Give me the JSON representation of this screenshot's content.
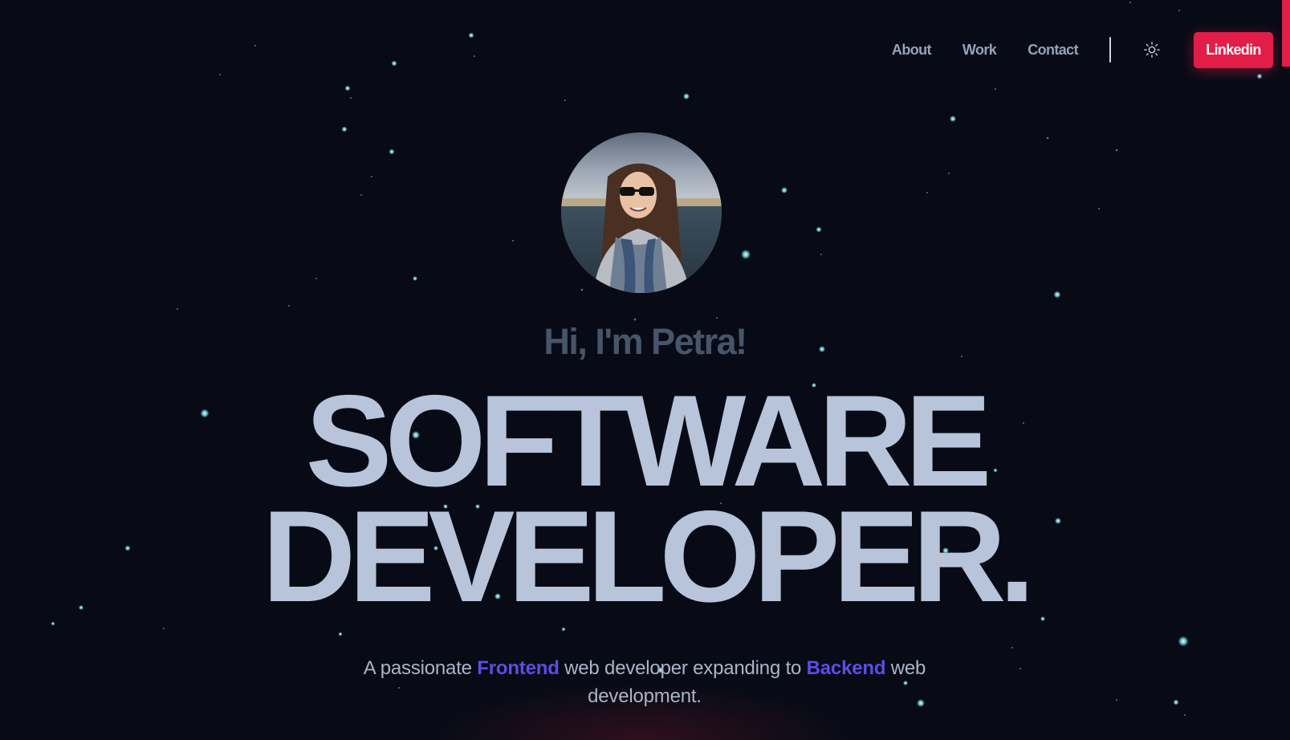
{
  "nav": {
    "items": [
      "About",
      "Work",
      "Contact"
    ],
    "theme_icon": "sun-icon",
    "cta_label": "Linkedin"
  },
  "hero": {
    "avatar_alt": "Photo of Petra",
    "greeting": "Hi, I'm Petra!",
    "headline_line1": "SOFTWARE",
    "headline_line2": "DEVELOPER.",
    "tagline": {
      "part1": "A passionate ",
      "highlight1": "Frontend",
      "part2": " web developer expanding to ",
      "highlight2": "Backend",
      "part3": " web development."
    }
  },
  "colors": {
    "background": "#080b16",
    "accent": "#e11d48",
    "highlight": "#5b4de6",
    "headline": "#b8c4da",
    "nav_text": "#94a3b8",
    "star": "#7ee0e6"
  }
}
